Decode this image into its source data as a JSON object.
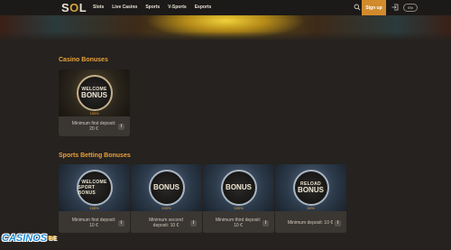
{
  "header": {
    "logo": "SOL",
    "nav": [
      "Slots",
      "Live Casino",
      "Sports",
      "V-Sports",
      "Esports"
    ],
    "signup_label": "Sign up",
    "lang": "EN"
  },
  "casino_section": {
    "title": "Casino Bonuses",
    "cards": [
      {
        "badge_line1": "WELCOME",
        "badge_line2": "BONUS",
        "pct": "150%",
        "desc": "Minimum first deposit: 20 €"
      }
    ]
  },
  "sports_section": {
    "title": "Sports Betting Bonuses",
    "cards": [
      {
        "badge_line1": "WELCOME",
        "badge_line2": "SPORT BONUS",
        "pct": "150%",
        "desc": "Minimum first deposit: 10 €"
      },
      {
        "badge_line1": "",
        "badge_line2": "BONUS",
        "pct": "100%",
        "desc": "Minimum second deposit: 10 €"
      },
      {
        "badge_line1": "",
        "badge_line2": "BONUS",
        "pct": "150%",
        "desc": "Minimum third deposit: 10 €"
      },
      {
        "badge_line1": "RELOAD",
        "badge_line2": "BONUS",
        "pct": "50%",
        "desc": "Minimum deposit: 10 €"
      }
    ]
  },
  "watermark": {
    "text": "CASINOS",
    "suffix": "BE"
  }
}
